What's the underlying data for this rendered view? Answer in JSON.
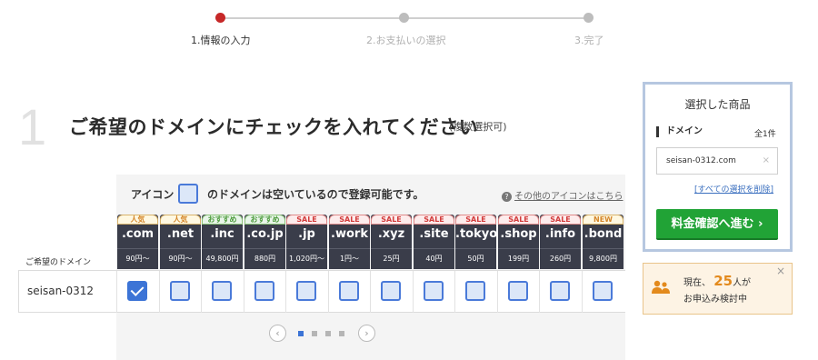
{
  "stepper": {
    "steps": [
      {
        "label": "1.情報の入力",
        "active": true
      },
      {
        "label": "2.お支払いの選択",
        "active": false
      },
      {
        "label": "3.完了",
        "active": false
      }
    ]
  },
  "heading": {
    "number": "1",
    "title": "ご希望のドメインにチェックを入れてください",
    "sub": "(複数選択可)"
  },
  "legend": {
    "prefix": "アイコン",
    "suffix": "のドメインは空いているので登録可能です。",
    "other_icons_link": "その他のアイコンはこちら"
  },
  "table": {
    "row_label_header": "ご希望のドメイン",
    "tlds": [
      {
        "badge": "人気",
        "badge_type": "pop",
        "name": ".com",
        "price": "90円〜"
      },
      {
        "badge": "人気",
        "badge_type": "pop",
        "name": ".net",
        "price": "90円〜"
      },
      {
        "badge": "おすすめ",
        "badge_type": "rec",
        "name": ".inc",
        "price": "49,800円"
      },
      {
        "badge": "おすすめ",
        "badge_type": "rec",
        "name": ".co.jp",
        "price": "880円"
      },
      {
        "badge": "SALE",
        "badge_type": "sale",
        "name": ".jp",
        "price": "1,020円〜"
      },
      {
        "badge": "SALE",
        "badge_type": "sale",
        "name": ".work",
        "price": "1円〜"
      },
      {
        "badge": "SALE",
        "badge_type": "sale",
        "name": ".xyz",
        "price": "25円"
      },
      {
        "badge": "SALE",
        "badge_type": "sale",
        "name": ".site",
        "price": "40円"
      },
      {
        "badge": "SALE",
        "badge_type": "sale",
        "name": ".tokyo",
        "price": "50円"
      },
      {
        "badge": "SALE",
        "badge_type": "sale",
        "name": ".shop",
        "price": "199円"
      },
      {
        "badge": "SALE",
        "badge_type": "sale",
        "name": ".info",
        "price": "260円"
      },
      {
        "badge": "NEW",
        "badge_type": "new",
        "name": ".bond",
        "price": "9,800円"
      }
    ],
    "row": {
      "domain": "seisan-0312",
      "checked": [
        true,
        false,
        false,
        false,
        false,
        false,
        false,
        false,
        false,
        false,
        false,
        false
      ]
    }
  },
  "pager": {
    "prev": "‹",
    "next": "›",
    "pages": 4,
    "current": 1
  },
  "sidebar": {
    "title": "選択した商品",
    "domain_label": "ドメイン",
    "count": "全1件",
    "selected_domain": "seisan-0312.com",
    "remove_icon": "×",
    "clear_all": "[すべての選択を削除]",
    "cta": "料金確認へ進む ›"
  },
  "notice": {
    "line1_prefix": "現在、",
    "count": "25",
    "line1_suffix": "人が",
    "line2": "お申込み検討中",
    "close": "×"
  },
  "colors": {
    "accent_red": "#c62828",
    "header_dark": "#3a3d4a",
    "checkbox_blue": "#3c74d6",
    "cta_green": "#21a336",
    "notice_orange": "#e38a1d"
  }
}
